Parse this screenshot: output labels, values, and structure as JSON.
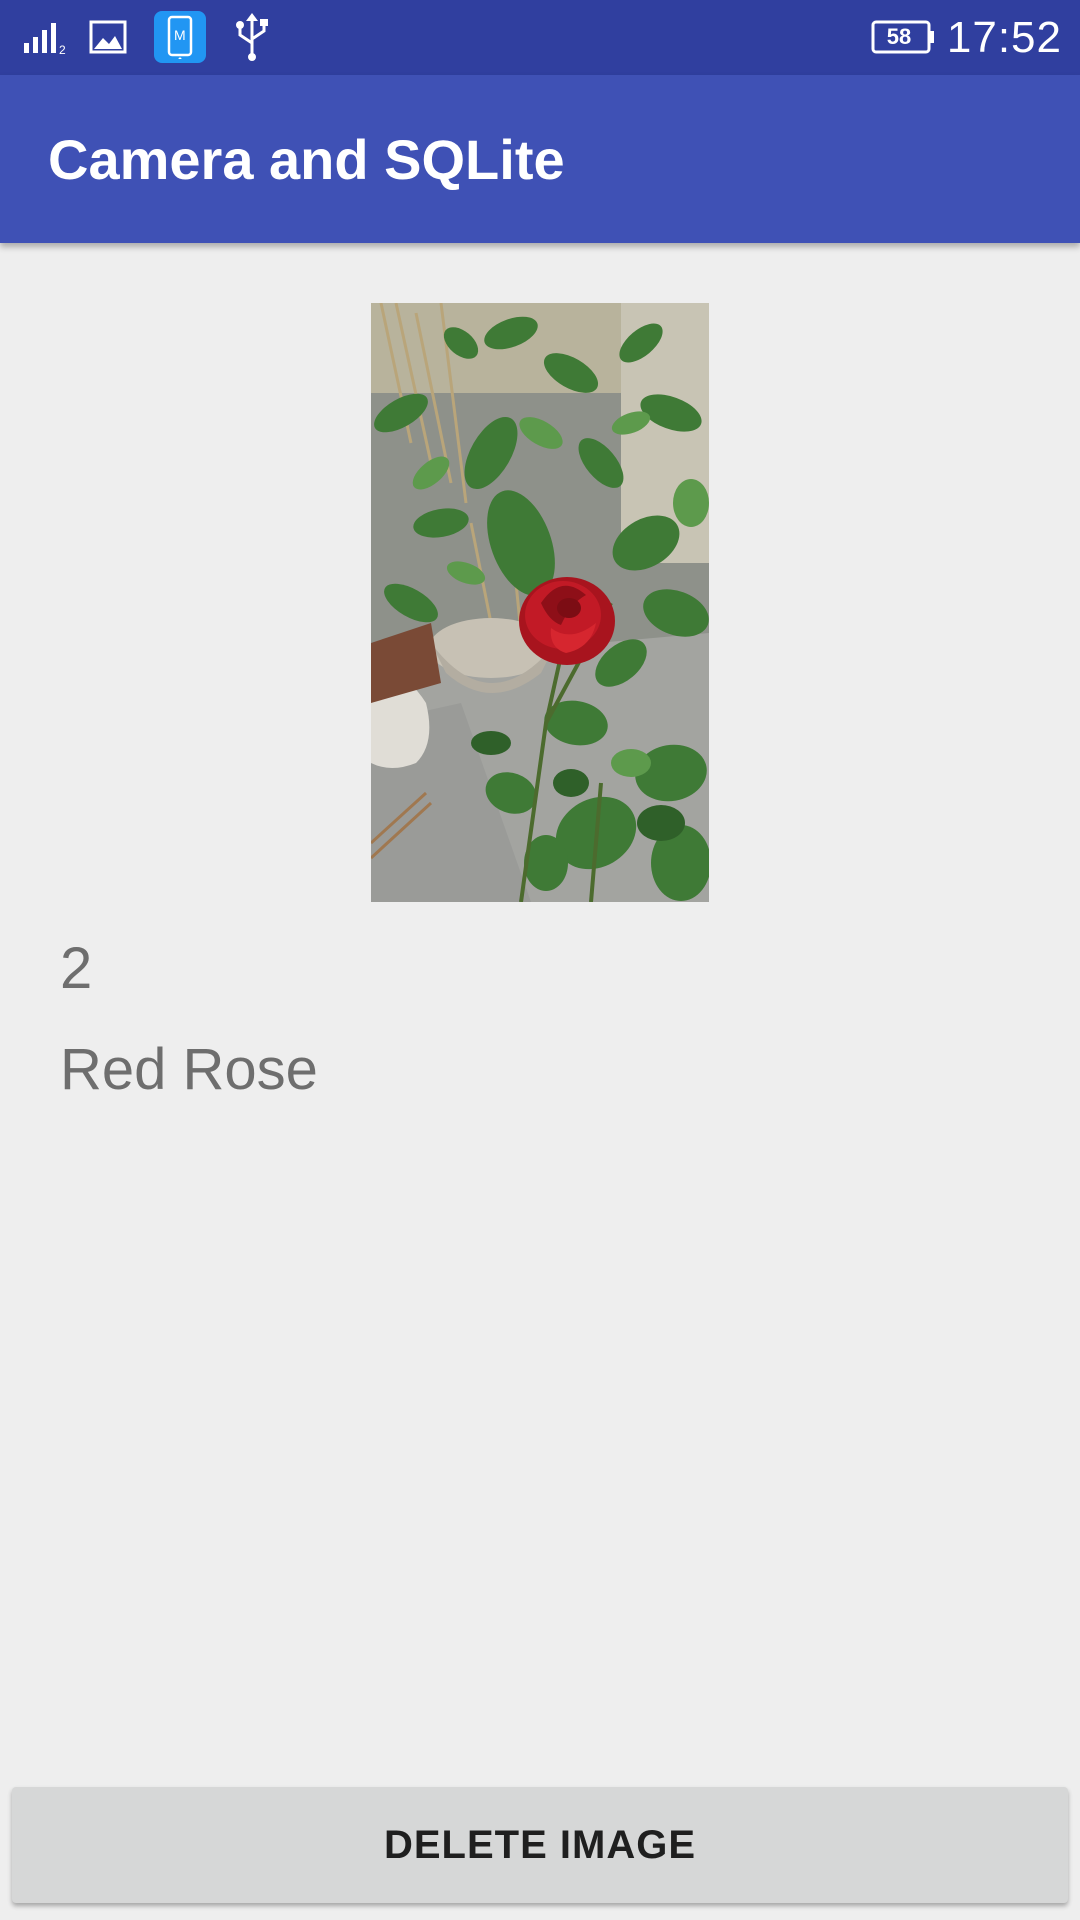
{
  "status_bar": {
    "icons": [
      "signal-icon",
      "gallery-icon",
      "phone-notification-icon",
      "usb-icon",
      "battery-icon"
    ],
    "battery_level": "58",
    "time": "17:52"
  },
  "app_bar": {
    "title": "Camera and SQLite"
  },
  "record": {
    "image_subject": "rose-photo",
    "id": "2",
    "name": "Red Rose"
  },
  "actions": {
    "delete_label": "DELETE IMAGE"
  },
  "colors": {
    "status_bar": "#303f9f",
    "app_bar": "#3f51b5",
    "background": "#eeeeee",
    "button": "#d6d7d7",
    "phone_badge": "#2196f3"
  }
}
